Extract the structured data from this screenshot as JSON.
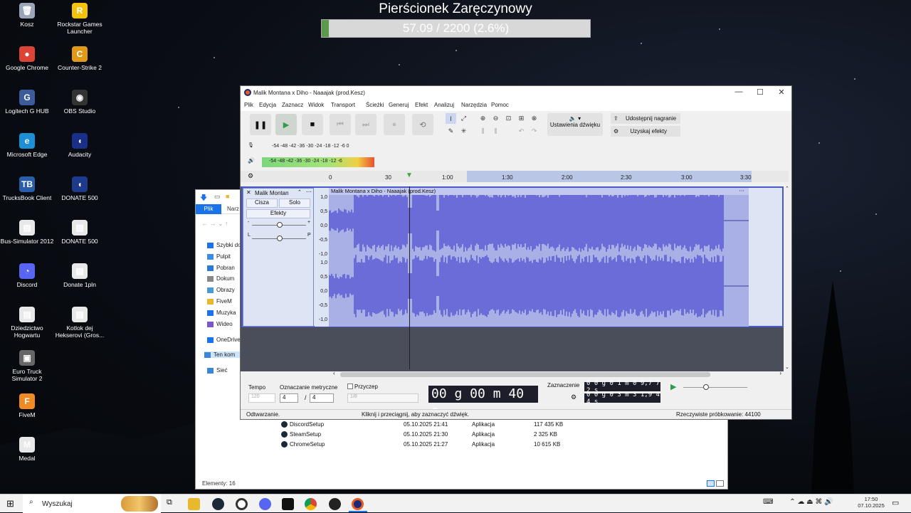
{
  "overlay": {
    "title": "Pierścionek Zaręczynowy",
    "progress_text": "57.09 / 2200 (2.6%)",
    "progress": 0.026
  },
  "desktop_icons": [
    {
      "label": "Kosz",
      "color": "#9aa6b8",
      "glyph": "🗑"
    },
    {
      "label": "Rockstar Games Launcher",
      "color": "#f4c20d",
      "glyph": "R"
    },
    {
      "label": "Google Chrome",
      "color": "#db4437",
      "glyph": "●"
    },
    {
      "label": "Counter-Strike 2",
      "color": "#e09a1a",
      "glyph": "C"
    },
    {
      "label": "Logitech G HUB",
      "color": "#3b5b9a",
      "glyph": "G"
    },
    {
      "label": "OBS Studio",
      "color": "#333",
      "glyph": "◉"
    },
    {
      "label": "Microsoft Edge",
      "color": "#1c8fd6",
      "glyph": "e"
    },
    {
      "label": "Audacity",
      "color": "#1a2f8a",
      "glyph": "◖"
    },
    {
      "label": "TrucksBook Client",
      "color": "#2a5ea8",
      "glyph": "TB"
    },
    {
      "label": "DONATE 500",
      "color": "#1e3a8a",
      "glyph": "◖"
    },
    {
      "label": "Bus-Simulator 2012",
      "color": "#e8e8e8",
      "glyph": "▤"
    },
    {
      "label": "DONATE 500",
      "color": "#e8e8e8",
      "glyph": "▤"
    },
    {
      "label": "Discord",
      "color": "#5865f2",
      "glyph": "◔"
    },
    {
      "label": "Donate 1pln",
      "color": "#e8e8e8",
      "glyph": "▤"
    },
    {
      "label": "Dziedzictwo Hogwartu",
      "color": "#e8e8e8",
      "glyph": "▤"
    },
    {
      "label": "Kotlok dej Hekserovi (Gros...",
      "color": "#e8e8e8",
      "glyph": "▤"
    },
    {
      "label": "Euro Truck Simulator 2",
      "color": "#666",
      "glyph": "▣"
    },
    {
      "label": "FiveM",
      "color": "#f08a24",
      "glyph": "F"
    },
    {
      "label": "Medal",
      "color": "#e8e8e8",
      "glyph": "M"
    }
  ],
  "explorer": {
    "tab_file": "Plik",
    "tab_second": "Narz",
    "sidebar": [
      "Szybki do",
      "Pulpit",
      "Pobran",
      "Dokum",
      "Obrazy",
      "FiveM",
      "Muzyka",
      "Wideo",
      "OneDrive",
      "Ten kom",
      "Sieć"
    ],
    "files": [
      {
        "name": "DiscordSetup",
        "date": "05.10.2025 21:41",
        "type": "Aplikacja",
        "size": "117 435 KB"
      },
      {
        "name": "SteamSetup",
        "date": "05.10.2025 21:30",
        "type": "Aplikacja",
        "size": "2 325 KB"
      },
      {
        "name": "ChromeSetup",
        "date": "05.10.2025 21:27",
        "type": "Aplikacja",
        "size": "10 615 KB"
      }
    ],
    "count": "Elementy: 16"
  },
  "audacity": {
    "title": "Malik Montana x Diho - Naaajak (prod.Kesz)",
    "menu": [
      "Plik",
      "Edycja",
      "Zaznacz",
      "Widok",
      "Transport",
      "Ścieżki",
      "Generuj",
      "Efekt",
      "Analizuj",
      "Narzędzia",
      "Pomoc"
    ],
    "audio_setup": "Ustawienia dźwięku",
    "share": "Udostępnij nagranie",
    "get_effects": "Uzyskaj efekty",
    "rec_meter": "-54 -48 -42 -36 -30 -24 -18 -12 -6 0",
    "play_meter": "-54 -48 -42 -36 -30 -24 -18 -12 -6",
    "ruler": [
      "0",
      "30",
      "1:00",
      "1:30",
      "2:00",
      "2:30",
      "3:00",
      "3:30"
    ],
    "track": {
      "name": "Malik Montan",
      "clip_name": "Malik Montana x Diho - Naaajak (prod.Kesz)",
      "mute": "Cisza",
      "solo": "Solo",
      "effects": "Efekty",
      "gain_minus": "-",
      "gain_plus": "+",
      "pan_left": "L",
      "pan_right": "P",
      "scale": [
        "1,0",
        "0,5",
        "0,0",
        "-0,5",
        "-1,0",
        "1,0",
        "0,5",
        "0,0",
        "-0,5",
        "-1,0"
      ]
    },
    "tempo_label": "Tempo",
    "tempo_value": "120",
    "meter_label": "Oznaczanie metryczne",
    "meter_num": "4",
    "meter_den": "4",
    "snap_label": "Przyczep",
    "snap_value": "1/8",
    "time": "00 g 00 m 40 s",
    "selection_label": "Zaznaczenie",
    "sel_start": "0 0 g 0 1 m 0 9,7 7 2 s",
    "sel_end": "0 0 g 0 3 m 3 1,9 4 4 s",
    "status_left": "Odtwarzanie.",
    "status_mid": "Kliknij i przeciągnij, aby zaznaczyć dźwięk.",
    "status_right": "Rzeczywiste próbkowanie: 44100"
  },
  "taskbar": {
    "search": "Wyszukaj",
    "time": "17:50",
    "date": "07.10.2025"
  }
}
